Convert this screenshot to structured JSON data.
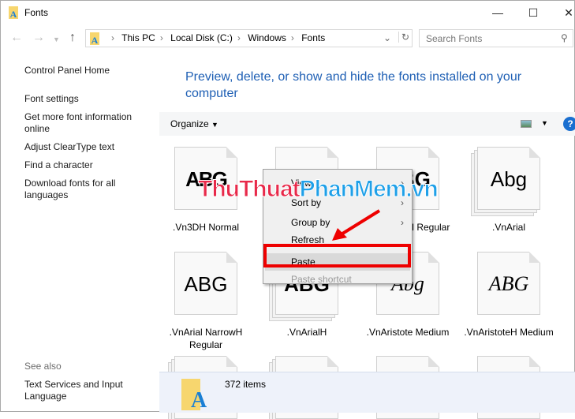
{
  "window": {
    "title": "Fonts",
    "minimize": "—",
    "maximize": "☐",
    "close": "✕"
  },
  "address": {
    "crumbs": [
      "This PC",
      "Local Disk (C:)",
      "Windows",
      "Fonts"
    ],
    "search_placeholder": "Search Fonts"
  },
  "sidebar": {
    "items": [
      "Control Panel Home",
      "Font settings",
      "Get more font information online",
      "Adjust ClearType text",
      "Find a character",
      "Download fonts for all languages"
    ],
    "see_also": "See also",
    "see_also_items": [
      "Text Services and Input Language"
    ]
  },
  "main": {
    "heading": "Preview, delete, or show and hide the fonts installed on your computer",
    "organize": "Organize"
  },
  "fonts": [
    {
      "name": ".Vn3DH Normal",
      "preview": "ABG"
    },
    {
      "name": "",
      "preview": "ABG"
    },
    {
      "name": ".VnArabiaH Regular",
      "preview": "ABG"
    },
    {
      "name": ".VnArial",
      "preview": "Abg"
    },
    {
      "name": ".VnArial NarrowH Regular",
      "preview": "ABG"
    },
    {
      "name": ".VnArialH",
      "preview": "ABG"
    },
    {
      "name": ".VnAristote Medium",
      "preview": "Abg"
    },
    {
      "name": ".VnAristoteH Medium",
      "preview": "ABG"
    }
  ],
  "context_menu": {
    "items": [
      {
        "label": "View",
        "submenu": true
      },
      {
        "label": "Sort by",
        "submenu": true
      },
      {
        "label": "Group by",
        "submenu": true
      },
      {
        "label": "Refresh"
      },
      {
        "label": "Paste",
        "highlighted": true
      },
      {
        "label": "Paste shortcut",
        "disabled": true
      }
    ]
  },
  "watermark": {
    "part1": "ThuThuat",
    "part2": "PhanMem.vn"
  },
  "status": {
    "count": "372 items"
  },
  "colors": {
    "link": "#1e5fb4",
    "highlight": "#e00000",
    "watermark_red": "#e8294a",
    "watermark_blue": "#1fa0e8"
  }
}
